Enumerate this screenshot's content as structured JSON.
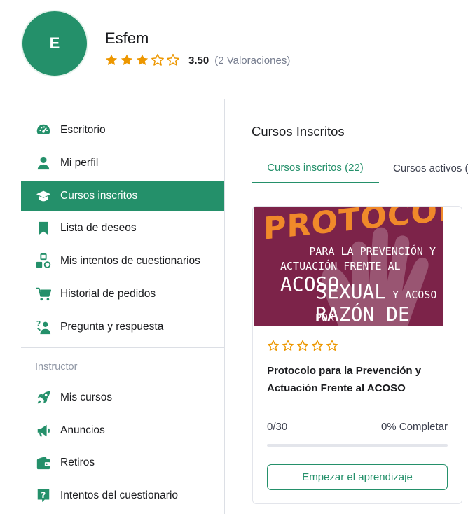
{
  "profile": {
    "initial": "E",
    "name": "Esfem",
    "rating_value": 3.5,
    "rating_avg": "3.50",
    "rating_count": "(2 Valoraciones)"
  },
  "sidebar": {
    "items": [
      {
        "label": "Escritorio",
        "icon": "dashboard-icon"
      },
      {
        "label": "Mi perfil",
        "icon": "user-icon"
      },
      {
        "label": "Cursos inscritos",
        "icon": "graduation-cap-icon"
      },
      {
        "label": "Lista de deseos",
        "icon": "bookmark-icon"
      },
      {
        "label": "Mis intentos de cuestionarios",
        "icon": "quiz-shapes-icon"
      },
      {
        "label": "Historial de pedidos",
        "icon": "cart-icon"
      },
      {
        "label": "Pregunta y respuesta",
        "icon": "question-person-icon"
      }
    ],
    "active_index": 2,
    "instructor_heading": "Instructor",
    "instructor_items": [
      {
        "label": "Mis cursos",
        "icon": "rocket-icon"
      },
      {
        "label": "Anuncios",
        "icon": "megaphone-icon"
      },
      {
        "label": "Retiros",
        "icon": "wallet-icon"
      },
      {
        "label": "Intentos del cuestionario",
        "icon": "question-box-icon"
      }
    ]
  },
  "main": {
    "title": "Cursos Inscritos",
    "tabs": [
      {
        "label": "Cursos inscritos (22)",
        "active": true
      },
      {
        "label": "Cursos activos (",
        "active": false
      }
    ]
  },
  "course": {
    "thumbnail": {
      "line1": "PROTOCOLO",
      "line2": "PARA LA PREVENCIÓN Y",
      "line3_small": "ACTUACIÓN FRENTE AL ",
      "line3_big": "ACOSO",
      "line4_big": "SEXUAL",
      "line4_small": " Y ACOSO POR",
      "line5": "RAZÓN DE SEXO"
    },
    "rating_value": 0,
    "title": "Protocolo para la Prevención y Actuación Frente al ACOSO",
    "progress_text": "0/30",
    "progress_percent": 0,
    "completed_label": "0% Completar",
    "button_label": "Empezar el aprendizaje"
  },
  "colors": {
    "accent": "#24906a",
    "star": "#ed9700",
    "thumb_bg": "#7c2349",
    "thumb_title": "#f0892a"
  }
}
